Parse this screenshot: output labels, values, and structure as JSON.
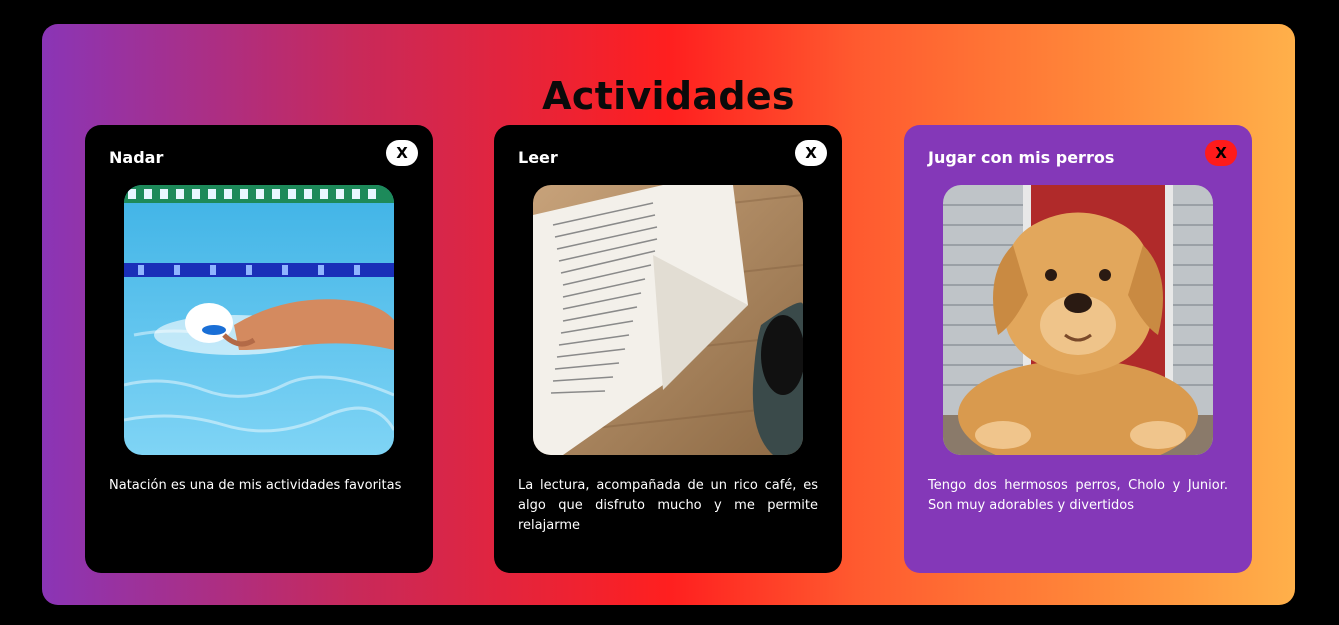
{
  "page": {
    "title": "Actividades"
  },
  "cards": [
    {
      "title": "Nadar",
      "close_label": "X",
      "image": "swimmer-photo",
      "description": "Natación es una de mis actividades favoritas"
    },
    {
      "title": "Leer",
      "close_label": "X",
      "image": "book-and-coffee-photo",
      "description": "La lectura, acompañada de un rico café, es algo que disfruto mucho y me permite relajarme"
    },
    {
      "title": "Jugar con mis perros",
      "close_label": "X",
      "image": "golden-retriever-photo",
      "description": "Tengo dos hermosos perros, Cholo y Junior. Son muy adorables y divertidos"
    }
  ],
  "colors": {
    "background": "#000000",
    "gradient": [
      "#8a35b6",
      "#ff1f1f",
      "#ffb04a"
    ],
    "highlight_card": "#8438b8",
    "highlight_close": "#ff1b1b"
  }
}
